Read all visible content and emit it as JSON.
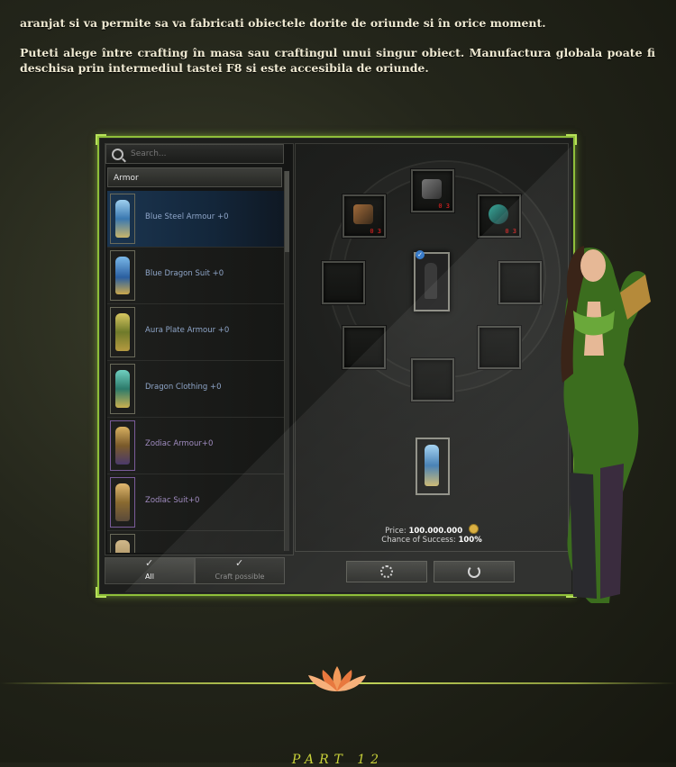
{
  "intro": {
    "paragraph1": "aranjat si va permite sa va fabricati obiectele dorite de oriunde si în orice moment.",
    "paragraph2": "Puteti alege între crafting în masa sau craftingul unui singur obiect. Manufactura globala poate fi deschisa prin intermediul tastei F8 si este accesibila de oriunde."
  },
  "crafting": {
    "search": {
      "placeholder": "Search..."
    },
    "category": "Armor",
    "items": [
      {
        "label": "Blue Steel Armour +0",
        "color": "#5b9bd1"
      },
      {
        "label": "Blue Dragon Suit +0",
        "color": "#3d7fc0"
      },
      {
        "label": "Aura Plate Armour +0",
        "color": "#9c9f3a"
      },
      {
        "label": "Dragon Clothing +0",
        "color": "#3a8c7a"
      },
      {
        "label": "Zodiac Armour+0",
        "color": "#a08438"
      },
      {
        "label": "Zodiac Suit+0",
        "color": "#b08a40"
      },
      {
        "label": "",
        "color": "#a89060"
      }
    ],
    "filters": {
      "all": "All",
      "craft_possible": "Craft possible"
    },
    "materials": [
      {
        "count": "0 3"
      },
      {
        "count": "0 3"
      },
      {
        "count": "0 3"
      }
    ],
    "price_label": "Price:",
    "price_value": "100.000.000",
    "chance_label": "Chance of Success:",
    "chance_value": "100%"
  },
  "section": {
    "title": "PART 12"
  }
}
